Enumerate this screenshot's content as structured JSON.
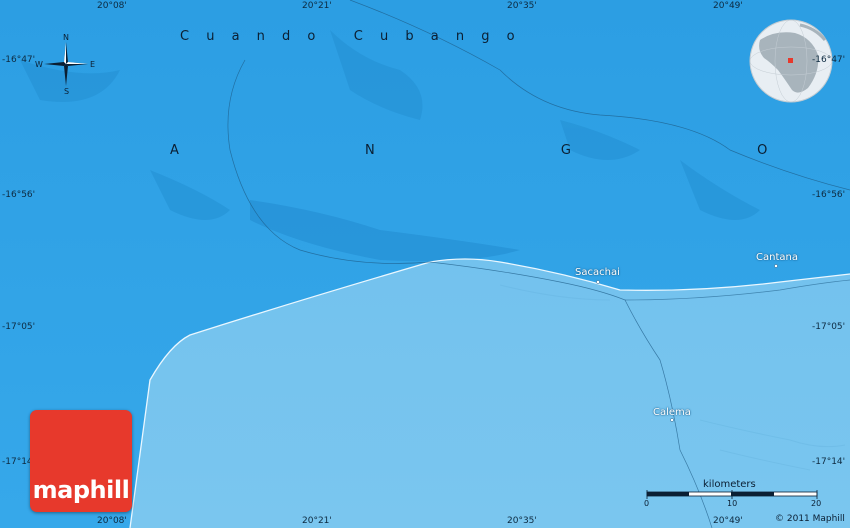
{
  "map": {
    "country": "A N G O L A",
    "province": "C u a n d o   C u b a n g o",
    "places": [
      {
        "name": "Sacachai"
      },
      {
        "name": "Cantana"
      },
      {
        "name": "Calema"
      }
    ],
    "lon_labels": {
      "top": [
        "20°08'",
        "20°21'",
        "20°35'",
        "20°49'"
      ],
      "bottom": [
        "20°08'",
        "20°21'",
        "20°35'",
        "20°49'"
      ]
    },
    "lat_labels": {
      "left": [
        "-16°47'",
        "-16°56'",
        "-17°05'",
        "-17°14'"
      ],
      "right": [
        "-16°47'",
        "-16°56'",
        "-17°05'",
        "-17°14'"
      ]
    },
    "compass": {
      "n": "N",
      "s": "S",
      "e": "E",
      "w": "W"
    },
    "scale": {
      "title": "kilometers",
      "ticks": [
        "0",
        "10",
        "20"
      ]
    },
    "logo": "maphill",
    "copyright": "© 2011 Maphill",
    "colors": {
      "water_light": "#2fa3e6",
      "water_dark": "#4bb5eb",
      "land": "#7cc7ee",
      "logo": "#e7392c"
    }
  }
}
